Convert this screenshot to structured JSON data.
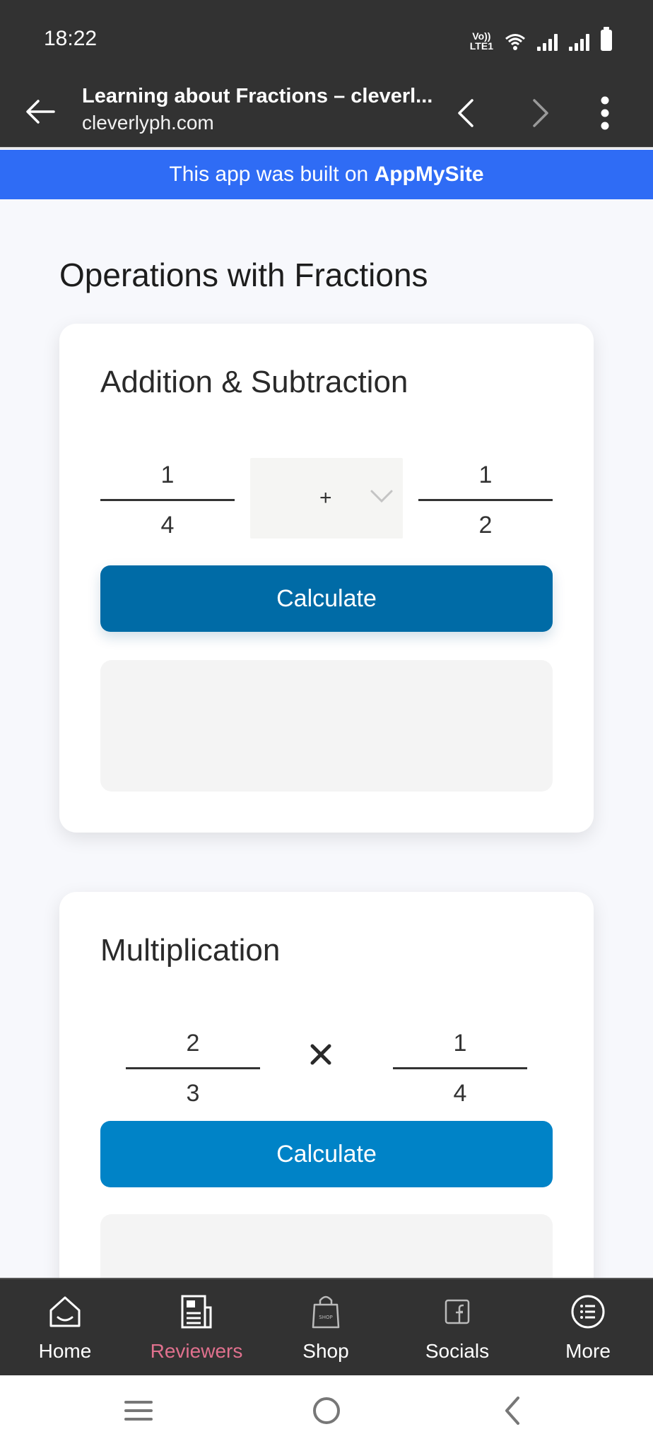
{
  "status": {
    "time": "18:22",
    "volte_top": "Vo))",
    "volte_bottom": "LTE1"
  },
  "browser": {
    "title": "Learning about Fractions – cleverl...",
    "url": "cleverlyph.com",
    "back_icon": "arrow-left-icon",
    "prev_icon": "chevron-left-icon",
    "next_icon": "chevron-right-icon",
    "menu_icon": "more-vert-icon"
  },
  "banner": {
    "prefix": "This app was built on ",
    "brand": "AppMySite"
  },
  "page": {
    "title": "Operations with Fractions"
  },
  "addition_card": {
    "title": "Addition & Subtraction",
    "left_fraction": {
      "numerator": "1",
      "denominator": "4"
    },
    "operator": "+",
    "right_fraction": {
      "numerator": "1",
      "denominator": "2"
    },
    "button_label": "Calculate",
    "button_color": "#006ba6",
    "result": ""
  },
  "multiplication_card": {
    "title": "Multiplication",
    "left_fraction": {
      "numerator": "2",
      "denominator": "3"
    },
    "operator_icon": "multiply-icon",
    "right_fraction": {
      "numerator": "1",
      "denominator": "4"
    },
    "button_label": "Calculate",
    "button_color": "#0083c7",
    "result": ""
  },
  "bottom_nav": {
    "items": [
      {
        "label": "Home",
        "icon": "home-icon"
      },
      {
        "label": "Reviewers",
        "icon": "newspaper-icon",
        "active": true,
        "active_color": "#e0718e"
      },
      {
        "label": "Shop",
        "icon": "shop-bag-icon",
        "badge": "SHOP"
      },
      {
        "label": "Socials",
        "icon": "facebook-icon"
      },
      {
        "label": "More",
        "icon": "list-icon"
      }
    ]
  },
  "system_nav": {
    "recents_icon": "recents-icon",
    "home_icon": "home-circle-icon",
    "back_icon": "back-chevron-icon"
  },
  "colors": {
    "status_bar": "#323232",
    "banner": "#2f6cf5",
    "page_bg": "#f7f8fc"
  }
}
